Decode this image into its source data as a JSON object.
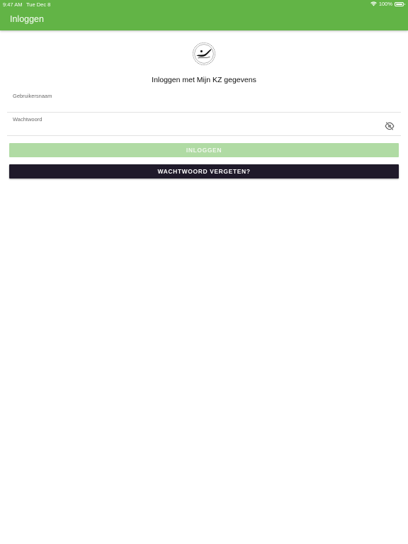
{
  "status_bar": {
    "time": "9:47 AM",
    "date": "Tue Dec 8",
    "battery": "100%"
  },
  "app_bar": {
    "title": "Inloggen"
  },
  "login": {
    "heading": "Inloggen met Mijn KZ gegevens",
    "username_label": "Gebruikersnaam",
    "username_value": "",
    "password_label": "Wachtwoord",
    "password_value": "",
    "login_button": "INLOGGEN",
    "forgot_button": "WACHTWOORD VERGETEN?"
  },
  "colors": {
    "accent": "#62b446",
    "login_button_disabled": "#b0dba4",
    "forgot_button": "#1f1a2a"
  },
  "icons": {
    "logo": "club-logo-icon",
    "password_toggle": "eye-off-icon",
    "wifi": "wifi-icon",
    "battery": "battery-icon"
  }
}
